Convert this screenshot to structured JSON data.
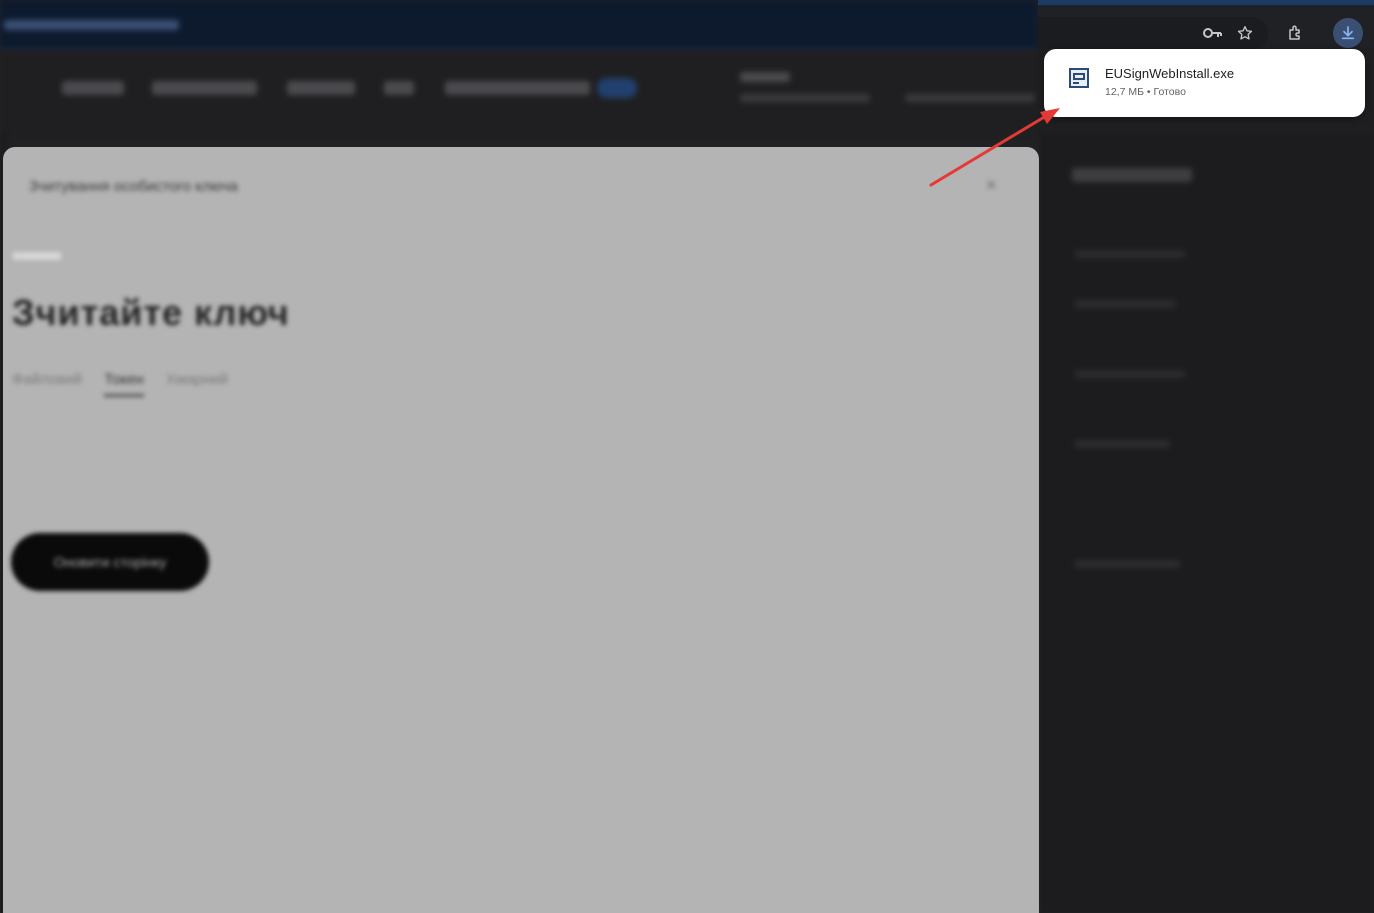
{
  "colors": {
    "arrow": "#e53935",
    "toolbar_bg": "#202124",
    "download_button_bg": "#3b4f73",
    "download_icon": "#8ab4f8",
    "bubble_bg": "#ffffff"
  },
  "browser_toolbar": {
    "icons": [
      "key-icon",
      "star-icon",
      "extensions-icon",
      "download-icon"
    ]
  },
  "download_bubble": {
    "file_name": "EUSignWebInstall.exe",
    "status": "12,7 МБ • Готово",
    "file_icon": "installer-file-icon"
  },
  "modal": {
    "title": "Зчитування особистого ключа",
    "close": "×",
    "heading": "Зчитайте ключ",
    "tabs": [
      {
        "label": "Файловий",
        "active": false
      },
      {
        "label": "Токен",
        "active": true
      },
      {
        "label": "Хмарний",
        "active": false
      }
    ],
    "update_button": "Оновити сторінку"
  }
}
